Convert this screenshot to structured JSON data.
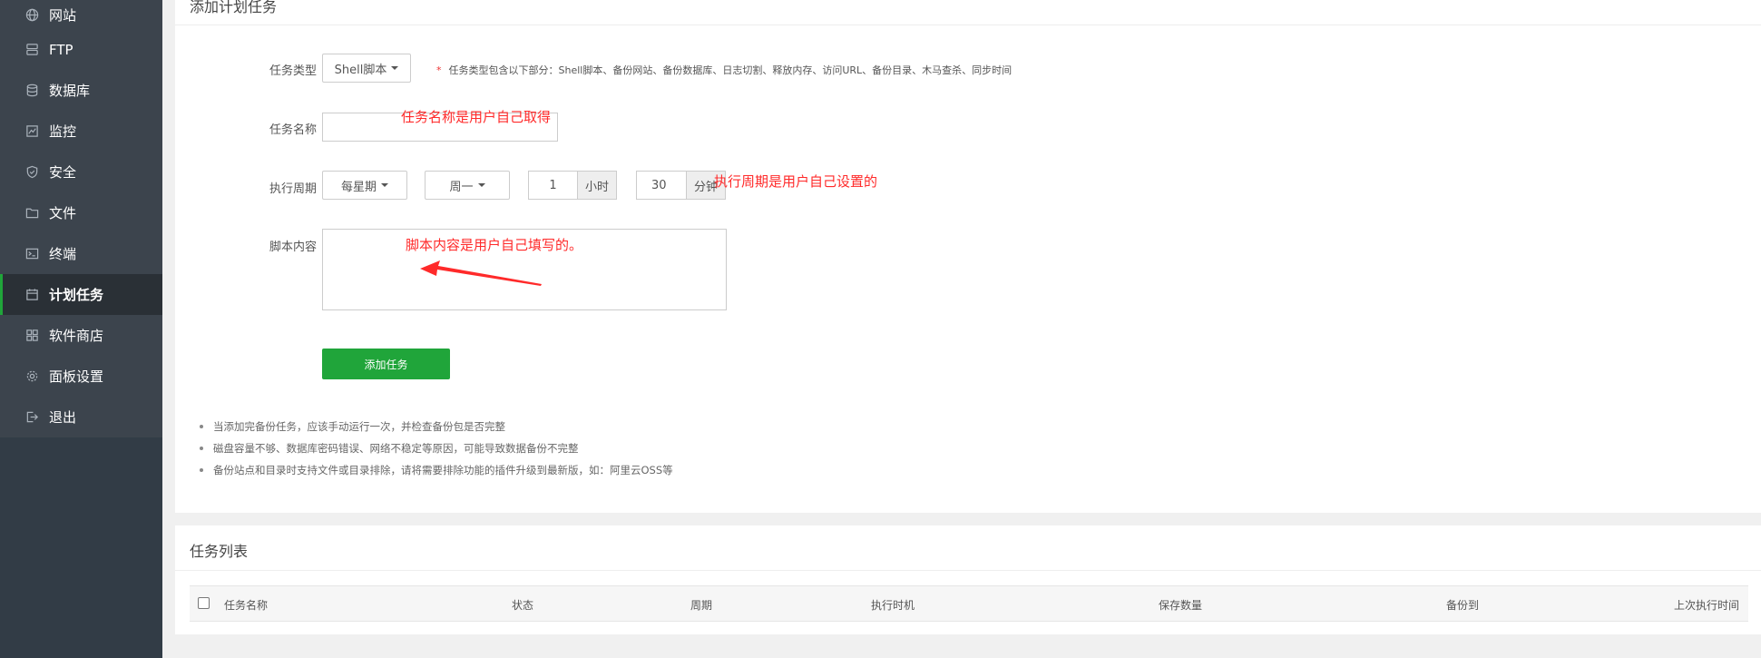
{
  "sidebar": {
    "items": [
      {
        "label": "网站",
        "icon": "globe-icon",
        "active": false
      },
      {
        "label": "FTP",
        "icon": "ftp-server-icon",
        "active": false
      },
      {
        "label": "数据库",
        "icon": "database-icon",
        "active": false
      },
      {
        "label": "监控",
        "icon": "monitor-chart-icon",
        "active": false
      },
      {
        "label": "安全",
        "icon": "shield-icon",
        "active": false
      },
      {
        "label": "文件",
        "icon": "folder-icon",
        "active": false
      },
      {
        "label": "终端",
        "icon": "terminal-icon",
        "active": false
      },
      {
        "label": "计划任务",
        "icon": "calendar-icon",
        "active": true
      },
      {
        "label": "软件商店",
        "icon": "grid-apps-icon",
        "active": false
      },
      {
        "label": "面板设置",
        "icon": "gear-icon",
        "active": false
      },
      {
        "label": "退出",
        "icon": "logout-icon",
        "active": false
      }
    ]
  },
  "add_task": {
    "title": "添加计划任务",
    "task_type_label": "任务类型",
    "task_type_value": "Shell脚本",
    "task_type_hint_star": "*",
    "task_type_hint": "任务类型包含以下部分：Shell脚本、备份网站、备份数据库、日志切割、释放内存、访问URL、备份目录、木马查杀、同步时间",
    "task_name_label": "任务名称",
    "task_name_value": "",
    "cycle_label": "执行周期",
    "cycle_type": "每星期",
    "cycle_week": "周一",
    "hour_value": "1",
    "hour_unit": "小时",
    "minute_value": "30",
    "minute_unit": "分钟",
    "script_label": "脚本内容",
    "script_value": "",
    "submit_label": "添加任务",
    "tips": [
      "当添加完备份任务，应该手动运行一次，并检查备份包是否完整",
      "磁盘容量不够、数据库密码错误、网络不稳定等原因，可能导致数据备份不完整",
      "备份站点和目录时支持文件或目录排除，请将需要排除功能的插件升级到最新版，如：阿里云OSS等"
    ]
  },
  "annotations": {
    "name_note": "任务名称是用户自己取得",
    "cycle_note": "执行周期是用户自己设置的",
    "script_note": "脚本内容是用户自己填写的。",
    "color": "#ff2a2a"
  },
  "task_list": {
    "title": "任务列表",
    "columns": [
      "任务名称",
      "状态",
      "周期",
      "执行时机",
      "保存数量",
      "备份到",
      "上次执行时间"
    ]
  },
  "colors": {
    "sidebar_bg": "#323c46",
    "accent_green": "#20a53a"
  }
}
